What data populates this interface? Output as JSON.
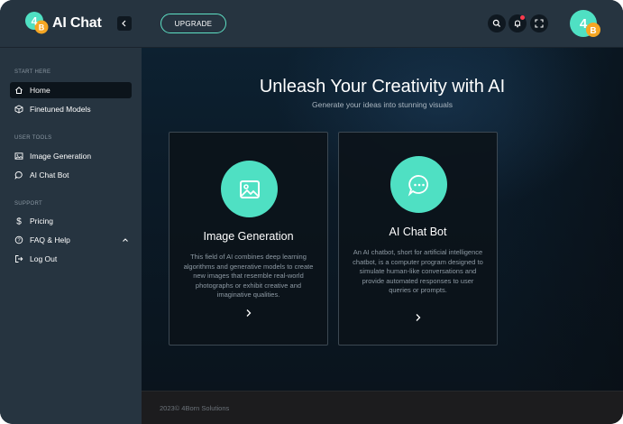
{
  "app": {
    "name": "AI Chat",
    "logo_mark": "4B"
  },
  "header": {
    "upgrade_label": "UPGRADE",
    "avatar_mark": "4B"
  },
  "sidebar": {
    "sections": [
      {
        "label": "START HERE"
      },
      {
        "label": "USER TOOLS"
      },
      {
        "label": "SUPPORT"
      }
    ],
    "items": [
      {
        "label": "Home",
        "icon": "home-icon"
      },
      {
        "label": "Finetuned Models",
        "icon": "cube-icon"
      },
      {
        "label": "Image Generation",
        "icon": "image-icon"
      },
      {
        "label": "AI Chat Bot",
        "icon": "chat-icon"
      },
      {
        "label": "Pricing",
        "icon": "dollar-icon"
      },
      {
        "label": "FAQ & Help",
        "icon": "help-icon"
      },
      {
        "label": "Log Out",
        "icon": "logout-icon"
      }
    ]
  },
  "hero": {
    "title": "Unleash Your Creativity with AI",
    "subtitle": "Generate your ideas into stunning visuals"
  },
  "cards": [
    {
      "title": "Image Generation",
      "description": "This field of AI combines deep learning algorithms and generative models to create new images that resemble real-world photographs or exhibit creative and imaginative qualities.",
      "icon": "image-icon"
    },
    {
      "title": "AI Chat Bot",
      "description": "An AI chatbot, short for artificial intelligence chatbot, is a computer program designed to simulate human-like conversations and provide automated responses to user queries or prompts.",
      "icon": "chat-bubble-icon"
    }
  ],
  "footer": {
    "copyright": "2023© 4Born Solutions"
  },
  "colors": {
    "accent": "#4fe0c3",
    "sidebar_bg": "#263440",
    "main_bg": "#0b1520",
    "notification": "#ff3b4e"
  }
}
